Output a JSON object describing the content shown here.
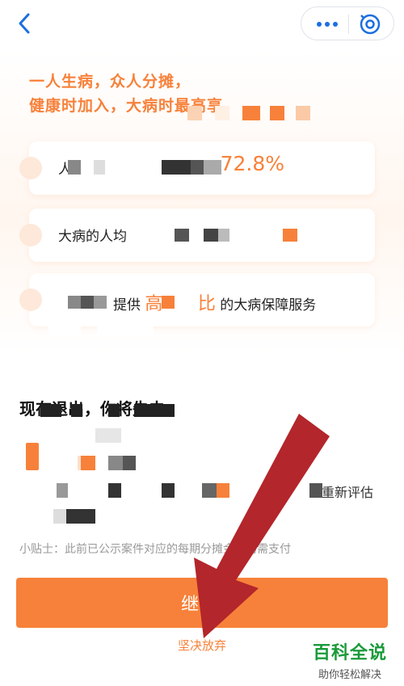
{
  "nav": {
    "back_icon": "chevron-left-icon",
    "more_icon": "more-dots-icon",
    "close_icon": "close-circle-icon"
  },
  "hero": {
    "line1": "一人生病，众人分摊，",
    "line2": "健康时加入，大病时最高享"
  },
  "cards": [
    {
      "prefix": "人",
      "highlight": "72.8%"
    },
    {
      "prefix": "大病的人均"
    },
    {
      "prefix": "提供",
      "highlight": "高",
      "highlight2": "比",
      "suffix": "的大病保障服务"
    }
  ],
  "exit": {
    "title": "现在退出，你将失去：",
    "reevaluate": "重新评估",
    "tip": "小贴士：此前已公示案件对应的每期分摊金额仍需支付"
  },
  "actions": {
    "continue_label": "继续",
    "abandon_label": "坚决放弃"
  },
  "watermark": {
    "name": "百科全说",
    "slogan": "助你轻松解决"
  },
  "colors": {
    "accent": "#f7813a",
    "nav_blue": "#1b6fe0",
    "arrow_red": "#b3262b",
    "watermark_green": "#1a9a3a"
  }
}
